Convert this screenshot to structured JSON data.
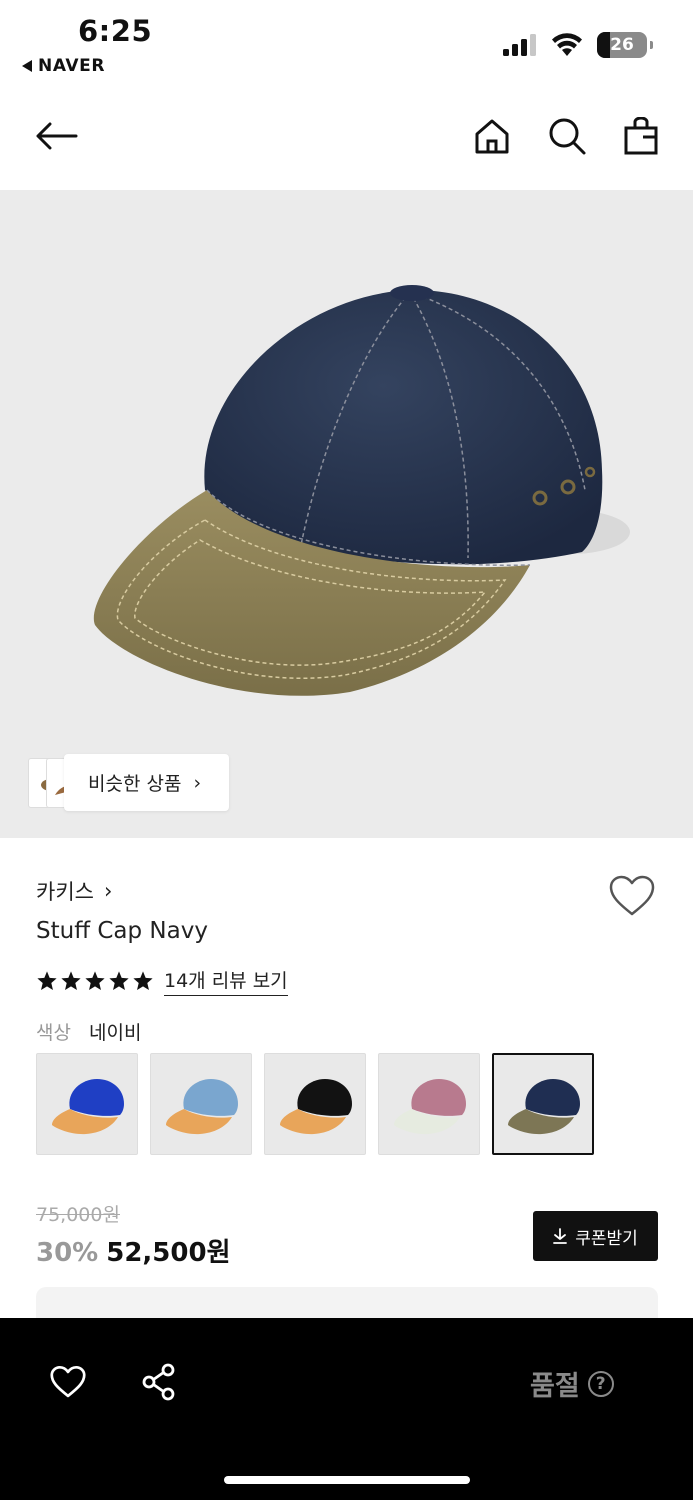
{
  "status_bar": {
    "time": "6:25",
    "back_app": "NAVER",
    "battery": "26",
    "battery_level": 0.26
  },
  "header": {
    "icons": [
      "back-arrow-icon",
      "home-icon",
      "search-icon",
      "shopping-bag-icon"
    ]
  },
  "hero": {
    "similar_label": "비슷한 상품",
    "similar_chevron": "›"
  },
  "product": {
    "brand": "카키스",
    "brand_chevron": "›",
    "title": "Stuff Cap Navy",
    "rating_stars": 5,
    "reviews_link": "14개 리뷰 보기",
    "color_label": "색상",
    "color_value": "네이비",
    "swatches": [
      {
        "crown": "#1f3fc4",
        "brim": "#e8a55a"
      },
      {
        "crown": "#7aa6cf",
        "brim": "#e8a55a"
      },
      {
        "crown": "#121212",
        "brim": "#e8a55a"
      },
      {
        "crown": "#b87a8e",
        "brim": "#e6ebe0"
      },
      {
        "crown": "#1f2e52",
        "brim": "#7d7655"
      }
    ],
    "selected_swatch": 4
  },
  "price": {
    "original": "75,000원",
    "discount": "30%",
    "final": "52,500원",
    "coupon_label": "쿠폰받기"
  },
  "bottom_bar": {
    "soldout_label": "품절",
    "help": "?"
  },
  "colors": {
    "hero_bg": "#ebebeb",
    "cap_crown": "#27344f",
    "cap_brim": "#8b7f56",
    "bottom_bar_bg": "#000000",
    "soldout_text": "#8a8a8a"
  }
}
